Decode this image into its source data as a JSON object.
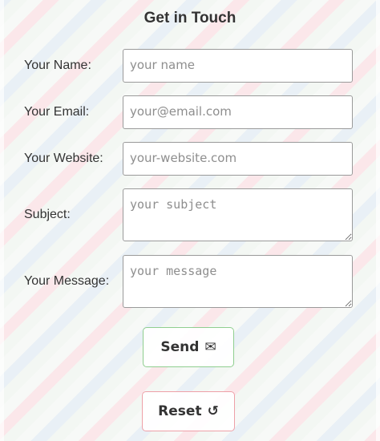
{
  "form": {
    "title": "Get in Touch",
    "fields": {
      "name": {
        "label": "Your Name:",
        "placeholder": "your name",
        "value": ""
      },
      "email": {
        "label": "Your Email:",
        "placeholder": "your@email.com",
        "value": ""
      },
      "website": {
        "label": "Your Website:",
        "placeholder": "your-website.com",
        "value": ""
      },
      "subject": {
        "label": "Subject:",
        "placeholder": "your subject",
        "value": ""
      },
      "message": {
        "label": "Your Message:",
        "placeholder": "your message",
        "value": ""
      }
    },
    "buttons": {
      "send": {
        "label": "Send",
        "icon": "envelope-icon",
        "icon_glyph": "✉",
        "border_color": "#8fce8f"
      },
      "reset": {
        "label": "Reset",
        "icon": "refresh-icon",
        "icon_glyph": "↺",
        "border_color": "#eea0a8"
      }
    }
  },
  "theme": {
    "stripe_colors": [
      "#fbe7ea",
      "#f7f9f7",
      "#e9f0f6"
    ],
    "text_color": "#333333"
  }
}
